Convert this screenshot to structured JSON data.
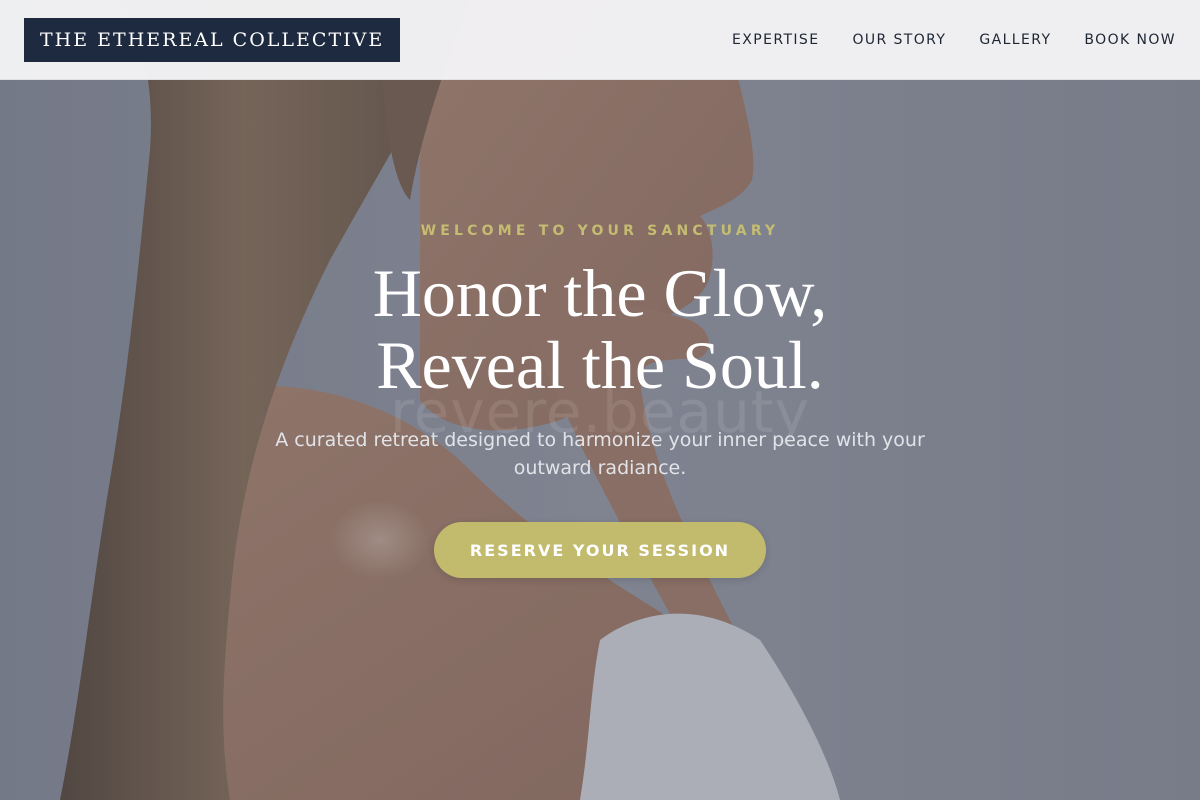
{
  "header": {
    "logo_text": "THE ETHEREAL COLLECTIVE",
    "nav": [
      {
        "label": "EXPERTISE"
      },
      {
        "label": "OUR STORY"
      },
      {
        "label": "GALLERY"
      },
      {
        "label": "BOOK NOW"
      }
    ]
  },
  "hero": {
    "eyebrow": "WELCOME TO YOUR SANCTUARY",
    "headline_line1": "Honor the Glow,",
    "headline_line2": "Reveal the Soul.",
    "watermark": "revere.beauty",
    "subtext": "A curated retreat designed to harmonize your inner peace with your outward radiance.",
    "cta_label": "RESERVE YOUR SESSION"
  },
  "colors": {
    "logo_bg": "#1e2a3f",
    "accent_gold": "#c2bb6e",
    "eyebrow_gold": "#c5bc72",
    "header_bg": "#f4f4f6",
    "overlay": "#3c4252"
  }
}
